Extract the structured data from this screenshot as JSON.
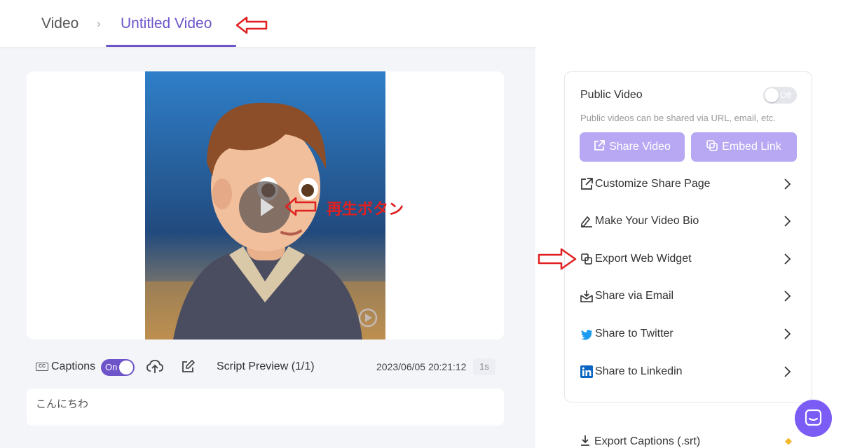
{
  "breadcrumb": {
    "root": "Video",
    "separator": "›",
    "current": "Untitled Video"
  },
  "annotations": {
    "play_button_note": "再生ボタン",
    "color": "#e02020"
  },
  "player": {
    "captions_label": "Captions",
    "captions_toggle": "On",
    "script_preview": "Script Preview (1/1)",
    "timestamp": "2023/06/05 20:21:12",
    "duration": "1s",
    "script_text": "こんにちわ",
    "watermark": "HeyGen"
  },
  "share_panel": {
    "public_video_title": "Public Video",
    "public_toggle": "Off",
    "public_desc": "Public videos can be shared via URL, email, etc.",
    "share_button": "Share Video",
    "embed_button": "Embed Link",
    "menu": [
      {
        "label": "Customize Share Page",
        "icon": "external-link-icon"
      },
      {
        "label": "Make Your Video Bio",
        "icon": "signature-icon"
      },
      {
        "label": "Export Web Widget",
        "icon": "widget-icon"
      },
      {
        "label": "Share via Email",
        "icon": "email-icon"
      },
      {
        "label": "Share to Twitter",
        "icon": "twitter-icon"
      },
      {
        "label": "Share to Linkedin",
        "icon": "linkedin-icon"
      }
    ],
    "export_captions": "Export Captions (.srt)"
  },
  "colors": {
    "accent": "#6d54c9",
    "button": "#b8a8f3",
    "chat": "#7b5cf5",
    "twitter": "#1d9bf0",
    "linkedin": "#0a66c2"
  }
}
